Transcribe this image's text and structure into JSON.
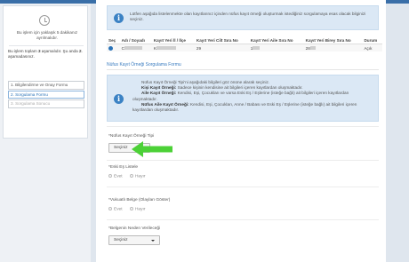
{
  "sidebar": {
    "session_text": "Bu işlem için yaklaşık 5 dakikanız ayrılmalıdır.",
    "steps_text_prefix": "Bu işlem toplam ",
    "steps_total": "3",
    "steps_text_mid": " aşamalıdır. Şu anda ",
    "steps_current": "2",
    "steps_text_suffix": ". aşamadasınız.",
    "steps": [
      {
        "label": "1. Bilgilendirme ve Onay Formu",
        "state": "done"
      },
      {
        "label": "2. Sorgulama Formu",
        "state": "active"
      },
      {
        "label": "3. Sorgulama Sonucu",
        "state": "disabled"
      }
    ]
  },
  "info_top": "Lütfen aşağıda listelenmekte olan kayıtlarınız içinden nüfus kayıt örneği oluşturmak istediğiniz sorgulamaya esas olacak bilginizi seçiniz.",
  "table": {
    "headers": [
      "Seç",
      "Adı / Soyadı",
      "Kayıt Yeri İl / İlçe",
      "Kayıt Yeri Cilt Sıra No",
      "Kayıt Yeri Aile Sıra No",
      "Kayıt Yeri Birey Sıra No",
      "Durum"
    ],
    "row": {
      "selected": true,
      "name_prefix": "C",
      "place_prefix": "K",
      "cilt": "29",
      "aile_prefix": "1",
      "birey_prefix": "28",
      "durum": "Açık"
    }
  },
  "form_title": "Nüfus Kayıt Örneği Sorgulama Formu",
  "info_form": {
    "line1": "Nüfus Kayıt Örneği Tipi'ni aşağıdaki bilgileri göz önüne alarak seçiniz.",
    "kisi_label": "Kişi Kayıt Örneği:",
    "kisi_text": " Sadece kişinin kendisine ait bilgileri içeren kayıtlardan oluşmaktadır.",
    "aile_label": "Aile Kayıt Örneği:",
    "aile_text": " Kendisi, Eşi, Çocukları ve varsa Eski Eş / Eşlerine (isteğe bağlı) ait bilgileri içeren kayıtlardan oluşmaktadır.",
    "nufus_label": "Nüfus Aile Kayıt Örneği:",
    "nufus_text": " Kendisi, Eşi, Çocukları, Anne / Babası ve Eski Eş / Eşlerine (isteğe bağlı) ait bilgileri içeren kayıtlardan oluşmaktadır."
  },
  "fields": {
    "tip": {
      "label": "*Nüfus Kayıt Örneği Tipi",
      "value": "Seçiniz"
    },
    "eski_es": {
      "label": "*Eski Eş Listele",
      "yes": "Evet",
      "no": "Hayır"
    },
    "vukuat": {
      "label": "*Vukuatlı Belge (Olayları Göster)",
      "yes": "Evet",
      "no": "Hayır"
    },
    "neden": {
      "label": "*Belgenin Neden Verileceği",
      "value": "Seçiniz"
    }
  },
  "colors": {
    "accent": "#2a73b8",
    "info_bg": "#dbe8f5",
    "arrow": "#4cd137"
  },
  "icons": [
    "clock-icon",
    "info-icon",
    "chevron-down-icon",
    "arrow-left-icon"
  ]
}
